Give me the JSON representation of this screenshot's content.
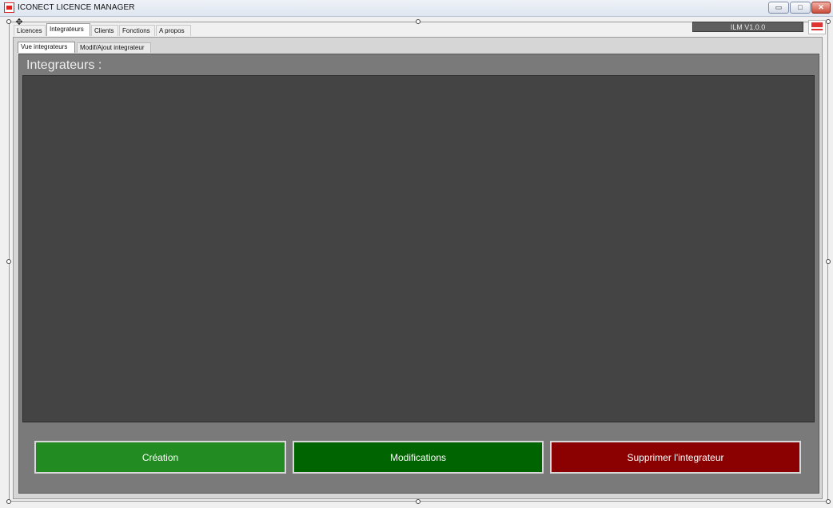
{
  "window": {
    "title": "ICONECT LICENCE MANAGER",
    "min_glyph": "▭",
    "max_glyph": "□",
    "close_glyph": "✕"
  },
  "tabs": [
    "Licences",
    "Integrateurs",
    "Clients",
    "Fonctions",
    "A propos"
  ],
  "active_tab": "Integrateurs",
  "version_label": "ILM V1.0.0",
  "subtabs": [
    "Vue integrateurs",
    "Modif/Ajout integrateur"
  ],
  "active_subtab": "Vue integrateurs",
  "panel": {
    "title": "Integrateurs :"
  },
  "buttons": {
    "create": "Création",
    "modify": "Modifications",
    "delete": "Supprimer l'integrateur"
  },
  "colors": {
    "create_button": "#228b22",
    "modify_button": "#006400",
    "delete_button": "#8b0000",
    "grid_background": "#444444",
    "panel_background": "#7a7a7a"
  },
  "icons": {
    "app": "app-logo-icon",
    "move": "move-cross-icon",
    "brand": "brand-logo-icon"
  }
}
